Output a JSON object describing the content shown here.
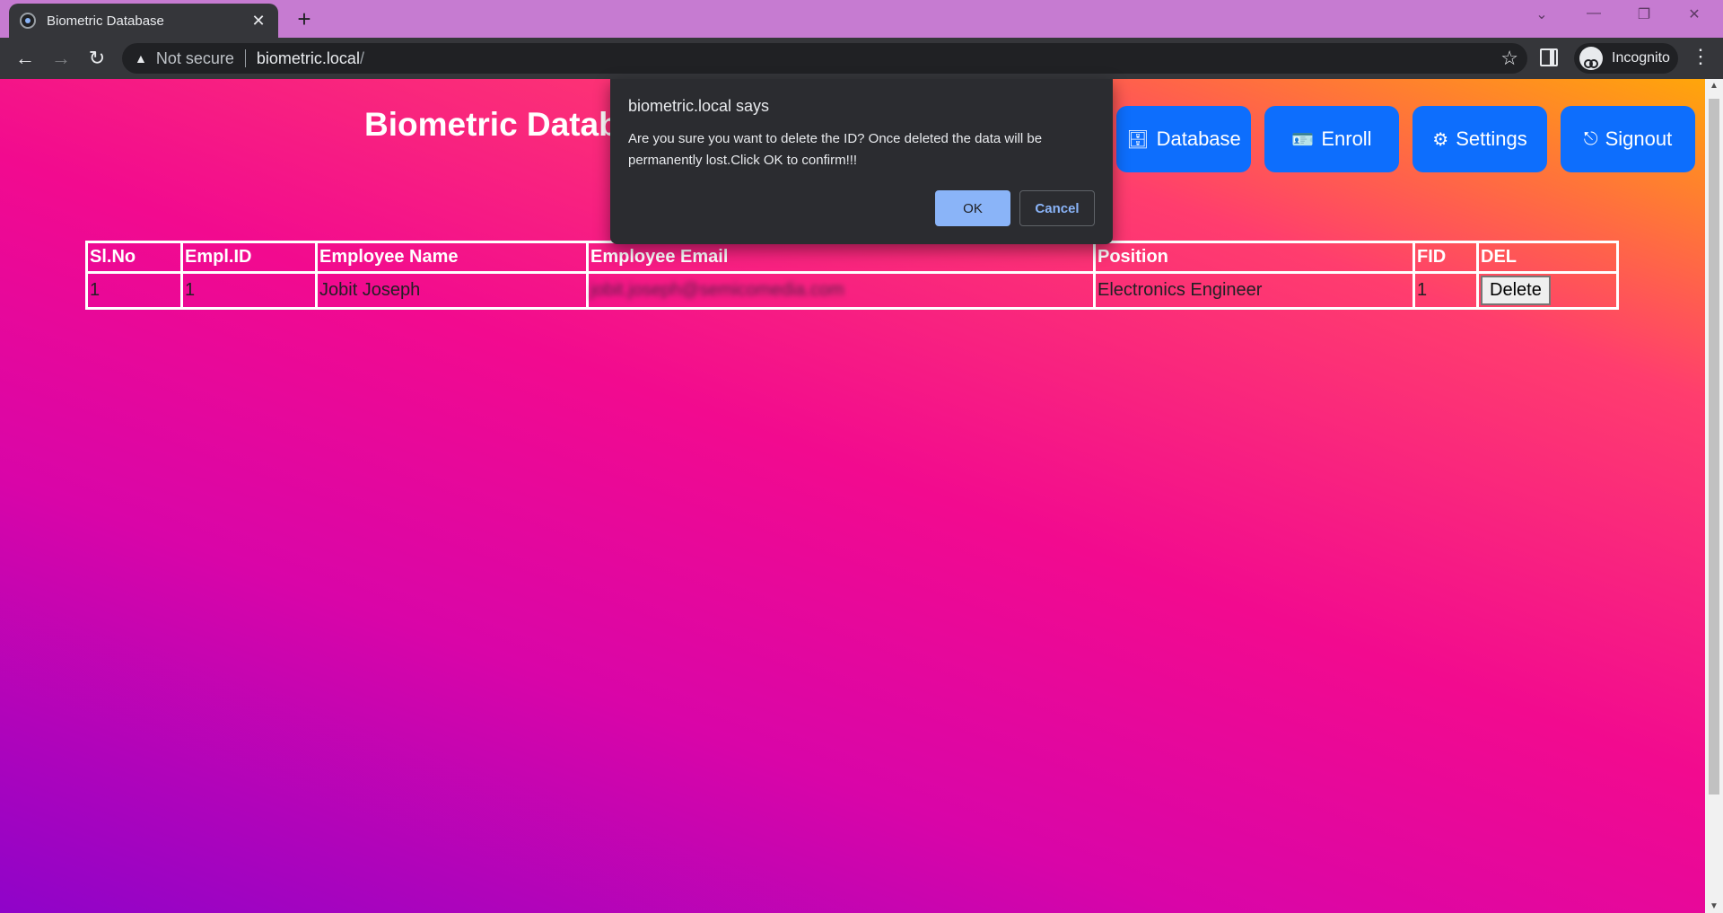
{
  "browser": {
    "tab_title": "Biometric Database",
    "tab_close": "✕",
    "new_tab": "+",
    "not_secure": "Not secure",
    "url_host": "biometric.local",
    "url_path": "/",
    "incognito_label": "Incognito"
  },
  "page": {
    "title": "Biometric Database",
    "nav": [
      {
        "label": "Database",
        "icon": "database-icon"
      },
      {
        "label": "Enroll",
        "icon": "id-card-icon"
      },
      {
        "label": "Settings",
        "icon": "gears-icon"
      },
      {
        "label": "Signout",
        "icon": "sign-out-icon"
      }
    ]
  },
  "table": {
    "headers": [
      "Sl.No",
      "Empl.ID",
      "Employee Name",
      "Employee Email",
      "Position",
      "FID",
      "DEL"
    ],
    "rows": [
      {
        "sl_no": "1",
        "empl_id": "1",
        "name": "Jobit Joseph",
        "email": "jobit.joseph@semicomedia.com",
        "position": "Electronics Engineer",
        "fid": "1",
        "delete_label": "Delete"
      }
    ]
  },
  "dialog": {
    "title": "biometric.local says",
    "message": "Are you sure you want to delete the ID? Once deleted the data will be permanently lost.Click OK to confirm!!!",
    "ok_label": "OK",
    "cancel_label": "Cancel"
  },
  "colors": {
    "accent": "#0d6efd",
    "dialog_bg": "#2b2c30",
    "ok_button": "#8ab4f8"
  }
}
